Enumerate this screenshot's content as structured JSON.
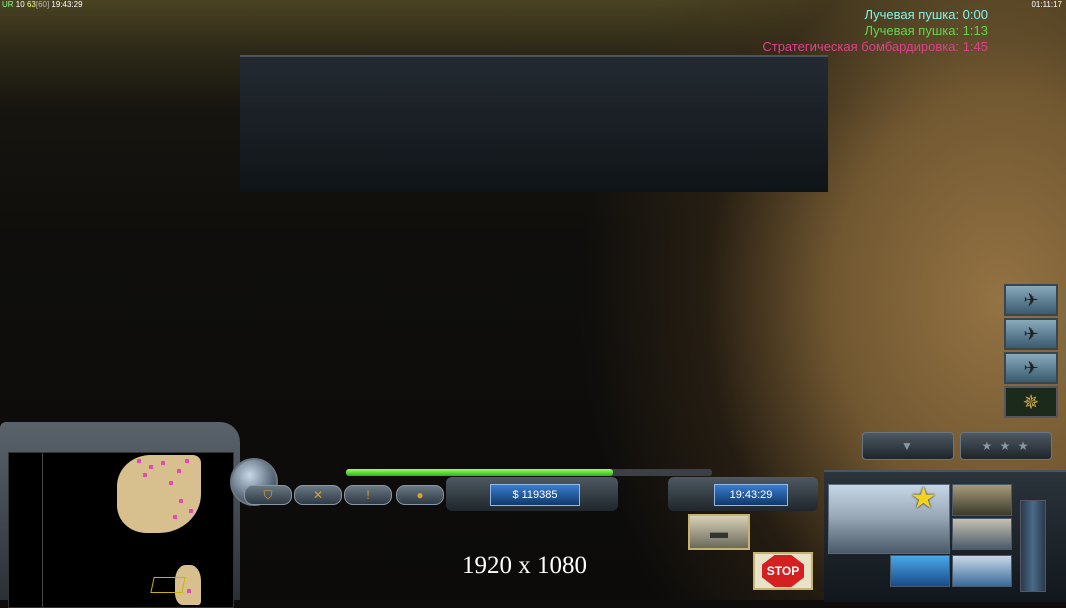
{
  "overlay": {
    "fps_label": "UR",
    "fps_val1": "10",
    "fps_val2": "63",
    "fps_val3": "[60]",
    "clock": "19:43:29",
    "game_time": "01:11:17"
  },
  "timers": [
    {
      "label": "Лучевая пушка: 0:00",
      "color": "#7ff5ea"
    },
    {
      "label": "Лучевая пушка: 1:13",
      "color": "#5fd84a"
    },
    {
      "label": "Стратегическая бомбардировка: 1:45",
      "color": "#e0408c"
    }
  ],
  "side_icons": [
    {
      "name": "aircraft-1-icon",
      "glyph": "✈"
    },
    {
      "name": "aircraft-2-icon",
      "glyph": "✈"
    },
    {
      "name": "aircraft-3-icon",
      "glyph": "✈"
    },
    {
      "name": "compass-icon",
      "glyph": "✵"
    }
  ],
  "command_buttons": [
    {
      "name": "guard-icon",
      "glyph": "⛉"
    },
    {
      "name": "crossed-tools-icon",
      "glyph": "✕"
    },
    {
      "name": "alert-icon",
      "glyph": "!"
    },
    {
      "name": "chat-icon",
      "glyph": "●"
    }
  ],
  "money": "$ 119385",
  "time_readout": "19:43:29",
  "resolution": "1920 x 1080",
  "stop_label": "STOP",
  "health_fraction": 0.73,
  "star_glyph": "★",
  "tabs": {
    "left": "▼",
    "right": "★ ★ ★"
  },
  "thumb_glyph": "▬"
}
